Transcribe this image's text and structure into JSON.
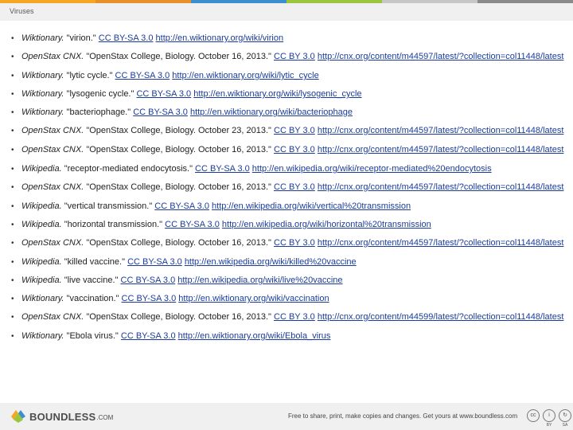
{
  "header": {
    "title": "Viruses"
  },
  "top_strip_colors": [
    "#f5a623",
    "#e8902a",
    "#3b8fce",
    "#9bc53d",
    "#c7c7c7",
    "#8a8a8a"
  ],
  "references": [
    {
      "source": "Wiktionary.",
      "text": " \"virion.\" ",
      "links": [
        "CC BY-SA 3.0",
        "http://en.wiktionary.org/wiki/virion"
      ]
    },
    {
      "source": "OpenStax CNX.",
      "text": " \"OpenStax College, Biology. October 16, 2013.\" ",
      "links": [
        "CC BY 3.0",
        "http://cnx.org/content/m44597/latest/?collection=col11448/latest"
      ]
    },
    {
      "source": "Wiktionary.",
      "text": " \"lytic cycle.\" ",
      "links": [
        "CC BY-SA 3.0",
        "http://en.wiktionary.org/wiki/lytic_cycle"
      ]
    },
    {
      "source": "Wiktionary.",
      "text": " \"lysogenic cycle.\" ",
      "links": [
        "CC BY-SA 3.0",
        "http://en.wiktionary.org/wiki/lysogenic_cycle"
      ]
    },
    {
      "source": "Wiktionary.",
      "text": " \"bacteriophage.\" ",
      "links": [
        "CC BY-SA 3.0",
        "http://en.wiktionary.org/wiki/bacteriophage"
      ]
    },
    {
      "source": "OpenStax CNX.",
      "text": " \"OpenStax College, Biology. October 23, 2013.\" ",
      "links": [
        "CC BY 3.0",
        "http://cnx.org/content/m44597/latest/?collection=col11448/latest"
      ]
    },
    {
      "source": "OpenStax CNX.",
      "text": " \"OpenStax College, Biology. October 16, 2013.\" ",
      "links": [
        "CC BY 3.0",
        "http://cnx.org/content/m44597/latest/?collection=col11448/latest"
      ]
    },
    {
      "source": "Wikipedia.",
      "text": " \"receptor-mediated endocytosis.\" ",
      "links": [
        "CC BY-SA 3.0",
        "http://en.wikipedia.org/wiki/receptor-mediated%20endocytosis"
      ]
    },
    {
      "source": "OpenStax CNX.",
      "text": " \"OpenStax College, Biology. October 16, 2013.\" ",
      "links": [
        "CC BY 3.0",
        "http://cnx.org/content/m44597/latest/?collection=col11448/latest"
      ]
    },
    {
      "source": "Wikipedia.",
      "text": " \"vertical transmission.\" ",
      "links": [
        "CC BY-SA 3.0",
        "http://en.wikipedia.org/wiki/vertical%20transmission"
      ]
    },
    {
      "source": "Wikipedia.",
      "text": " \"horizontal transmission.\" ",
      "links": [
        "CC BY-SA 3.0",
        "http://en.wikipedia.org/wiki/horizontal%20transmission"
      ]
    },
    {
      "source": "OpenStax CNX.",
      "text": " \"OpenStax College, Biology. October 16, 2013.\" ",
      "links": [
        "CC BY 3.0",
        "http://cnx.org/content/m44597/latest/?collection=col11448/latest"
      ]
    },
    {
      "source": "Wikipedia.",
      "text": " \"killed vaccine.\" ",
      "links": [
        "CC BY-SA 3.0",
        "http://en.wikipedia.org/wiki/killed%20vaccine"
      ]
    },
    {
      "source": "Wikipedia.",
      "text": " \"live vaccine.\" ",
      "links": [
        "CC BY-SA 3.0",
        "http://en.wikipedia.org/wiki/live%20vaccine"
      ]
    },
    {
      "source": "Wiktionary.",
      "text": " \"vaccination.\" ",
      "links": [
        "CC BY-SA 3.0",
        "http://en.wiktionary.org/wiki/vaccination"
      ]
    },
    {
      "source": "OpenStax CNX.",
      "text": " \"OpenStax College, Biology. October 16, 2013.\" ",
      "links": [
        "CC BY 3.0",
        "http://cnx.org/content/m44599/latest/?collection=col11448/latest"
      ]
    },
    {
      "source": "Wiktionary.",
      "text": " \"Ebola virus.\" ",
      "links": [
        "CC BY-SA 3.0",
        "http://en.wiktionary.org/wiki/Ebola_virus"
      ]
    }
  ],
  "footer": {
    "logo_text": "BOUNDLESS",
    "logo_suffix": ".COM",
    "note": "Free to share, print, make copies and changes. Get yours at www.boundless.com",
    "license_badges": [
      {
        "icon": "cc-icon",
        "glyph": "cc",
        "caption": ""
      },
      {
        "icon": "by-icon",
        "glyph": "i",
        "caption": "BY"
      },
      {
        "icon": "sa-icon",
        "glyph": "↻",
        "caption": "SA"
      }
    ],
    "logo_colors": [
      "#f5a623",
      "#3b8fce",
      "#9bc53d"
    ]
  }
}
